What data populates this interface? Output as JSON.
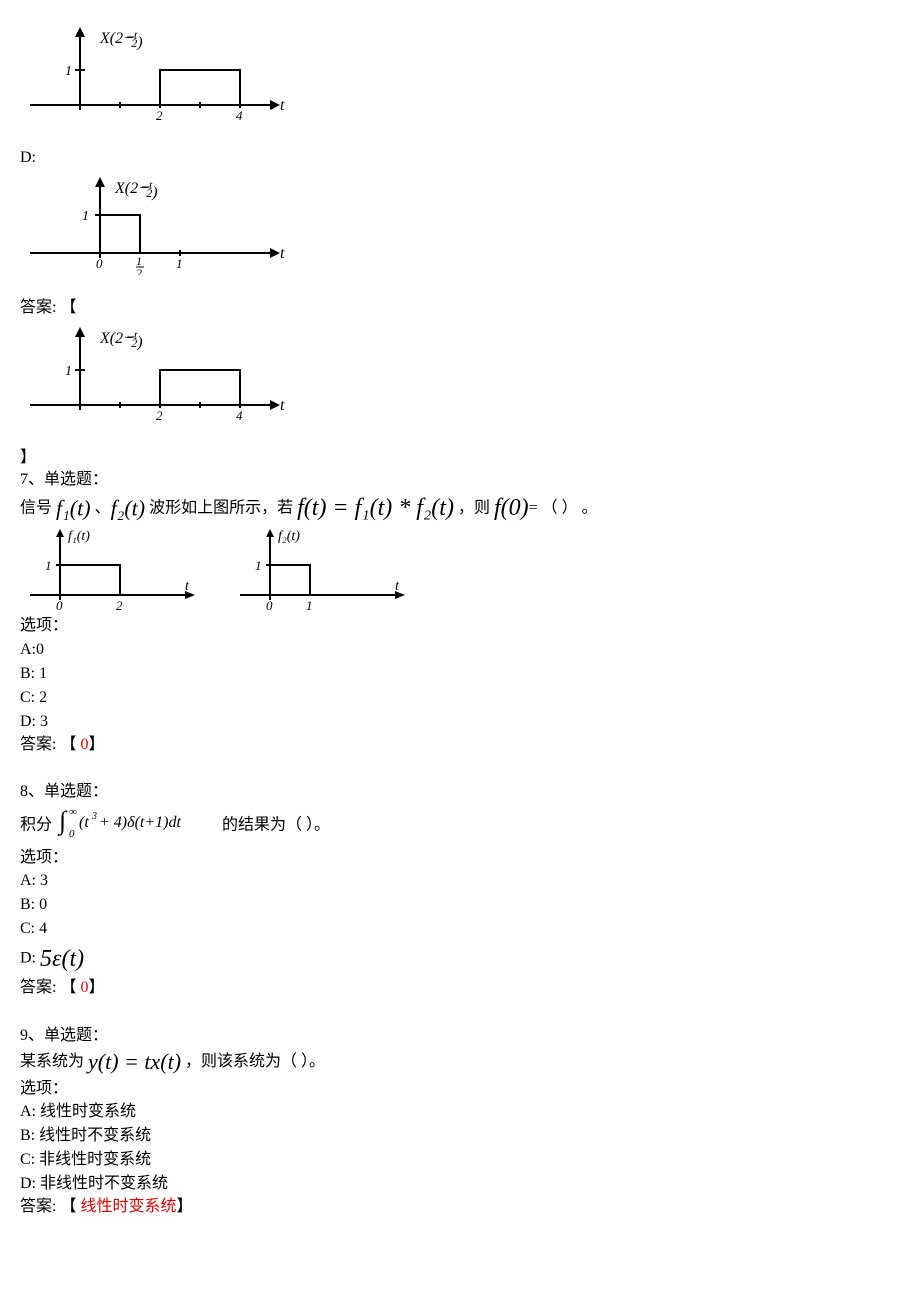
{
  "graph_c_top": {
    "y_label": "X(2−t/2)",
    "y_tick": "1",
    "x_label": "t",
    "x_ticks": [
      "2",
      "4"
    ]
  },
  "option_d_label": "D:",
  "graph_d": {
    "y_label": "X(2−t/2)",
    "y_tick": "1",
    "x_label": "t",
    "x_origin": "0",
    "x_ticks_half": "1/2",
    "x_tick_1": "1"
  },
  "answer_prefix": "答案: 【",
  "answer_suffix": "】",
  "graph_answer": {
    "y_label": "X(2−t/2)",
    "y_tick": "1",
    "x_label": "t",
    "x_ticks": [
      "2",
      "4"
    ]
  },
  "q7": {
    "num_label": "7、单选题：",
    "prefix": "信号 ",
    "f1": "f₁(t)",
    "sep": " 、",
    "f2": "f₂(t)",
    "mid": " 波形如上图所示，若 ",
    "conv": "f(t) = f₁(t) * f₂(t)",
    "mid2": " ，则 ",
    "f0": "f(0)",
    "tail": "= （ ） 。",
    "graph1": {
      "label": "f₁(t)",
      "y_tick": "1",
      "x_label": "t",
      "x_origin": "0",
      "x_end": "2"
    },
    "graph2": {
      "label": "f₂(t)",
      "y_tick": "1",
      "x_label": "t",
      "x_origin": "0",
      "x_end": "1"
    },
    "options_label": "选项：",
    "opt_a": "A:0",
    "opt_b": "B: 1",
    "opt_c": "C: 2",
    "opt_d": "D: 3",
    "answer_prefix": "答案: 【 ",
    "answer_value": "0",
    "answer_suffix": "】"
  },
  "q8": {
    "num_label": "8、单选题：",
    "prefix": "积分 ",
    "integral_text": "∫₀^∞ (t³ + 4)δ(t+1)dt",
    "mid": " 的结果为（        ）。",
    "options_label": "选项：",
    "opt_a": "A: 3",
    "opt_b": "B: 0",
    "opt_c": "C: 4",
    "opt_d_prefix": "D: ",
    "opt_d_math": "5ε(t)",
    "answer_prefix": "答案: 【  ",
    "answer_value": "0",
    "answer_suffix": "】"
  },
  "q9": {
    "num_label": "9、单选题：",
    "prefix": "某系统为 ",
    "eq": "y(t) = tx(t)",
    "mid": " ，则该系统为（  ）。",
    "options_label": "选项：",
    "opt_a": "A: 线性时变系统",
    "opt_b": "B: 线性时不变系统",
    "opt_c": "C: 非线性时变系统",
    "opt_d": "D: 非线性时不变系统",
    "answer_prefix": "答案: 【 ",
    "answer_value": "线性时变系统",
    "answer_suffix": "】"
  },
  "chart_data": [
    {
      "id": "graph_c_top",
      "type": "line",
      "title": "X(2−t/2)",
      "xlabel": "t",
      "ylabel": "",
      "x": [
        0,
        2,
        2,
        4,
        4
      ],
      "y": [
        0,
        0,
        1,
        1,
        0
      ],
      "xlim": [
        0,
        5
      ],
      "ylim": [
        0,
        1.2
      ],
      "y_ticks": [
        1
      ],
      "x_ticks": [
        2,
        4
      ]
    },
    {
      "id": "graph_d",
      "type": "line",
      "title": "X(2−t/2)",
      "xlabel": "t",
      "ylabel": "",
      "x": [
        0,
        0,
        0.5,
        0.5
      ],
      "y": [
        0,
        1,
        1,
        0
      ],
      "xlim": [
        -0.2,
        1.5
      ],
      "ylim": [
        0,
        1.2
      ],
      "y_ticks": [
        1
      ],
      "x_ticks": [
        0,
        0.5,
        1
      ]
    },
    {
      "id": "graph_answer",
      "type": "line",
      "title": "X(2−t/2)",
      "xlabel": "t",
      "ylabel": "",
      "x": [
        0,
        2,
        2,
        4,
        4
      ],
      "y": [
        0,
        0,
        1,
        1,
        0
      ],
      "xlim": [
        0,
        5
      ],
      "ylim": [
        0,
        1.2
      ],
      "y_ticks": [
        1
      ],
      "x_ticks": [
        2,
        4
      ]
    },
    {
      "id": "q7_graph1",
      "type": "line",
      "title": "f₁(t)",
      "xlabel": "t",
      "ylabel": "",
      "x": [
        0,
        0,
        2,
        2
      ],
      "y": [
        0,
        1,
        1,
        0
      ],
      "xlim": [
        0,
        3
      ],
      "ylim": [
        0,
        1.2
      ],
      "y_ticks": [
        1
      ],
      "x_ticks": [
        0,
        2
      ]
    },
    {
      "id": "q7_graph2",
      "type": "line",
      "title": "f₂(t)",
      "xlabel": "t",
      "ylabel": "",
      "x": [
        0,
        0,
        1,
        1
      ],
      "y": [
        0,
        1,
        1,
        0
      ],
      "xlim": [
        0,
        2
      ],
      "ylim": [
        0,
        1.2
      ],
      "y_ticks": [
        1
      ],
      "x_ticks": [
        0,
        1
      ]
    }
  ]
}
